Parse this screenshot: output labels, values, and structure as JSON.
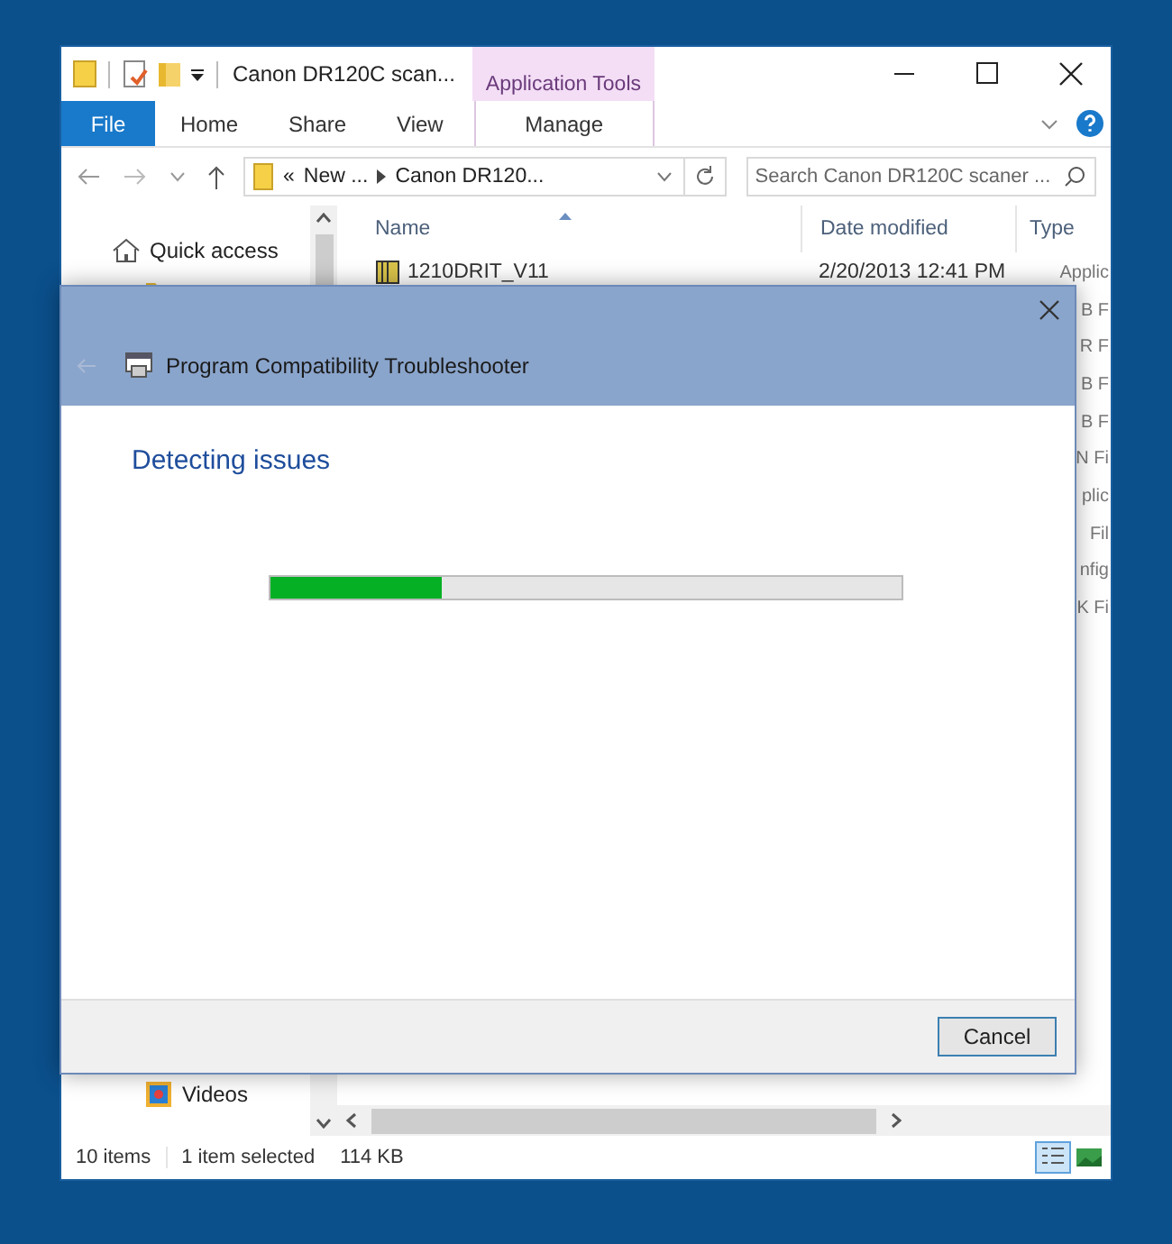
{
  "explorer": {
    "title": "Canon DR120C scan...",
    "context_tab": "Application Tools",
    "file_button": "File",
    "ribbon_tabs": [
      {
        "label": "Home",
        "kind": "normal"
      },
      {
        "label": "Share",
        "kind": "normal"
      },
      {
        "label": "View",
        "kind": "normal"
      },
      {
        "label": "Manage",
        "kind": "context"
      }
    ],
    "address": {
      "overflow": "«",
      "crumbs": [
        "New ...",
        "Canon DR120..."
      ]
    },
    "search": {
      "placeholder": "Search Canon DR120C scaner ..."
    },
    "nav_items": [
      {
        "label": "Quick access",
        "kind": "home"
      },
      {
        "kind": "folder"
      }
    ],
    "nav_bottom": [
      {
        "label": "Videos",
        "kind": "videos"
      }
    ],
    "columns": [
      "Name",
      "Date modified",
      "Type"
    ],
    "rows": [
      {
        "name": "1210DRIT_V11",
        "date": "2/20/2013 12:41 PM",
        "type": "Applic"
      },
      {
        "type": "B F"
      },
      {
        "type": "R F"
      },
      {
        "type": "B F"
      },
      {
        "type": "B F"
      },
      {
        "type": "N Fi"
      },
      {
        "type": "plic"
      },
      {
        "type": "Fil"
      },
      {
        "type": "nfig"
      },
      {
        "type": "K Fi"
      }
    ],
    "status": [
      "10 items",
      "1 item selected",
      "114 KB"
    ]
  },
  "dialog": {
    "title": "Program Compatibility Troubleshooter",
    "heading": "Detecting issues",
    "progress": {
      "level": 0.27
    },
    "buttons": [
      "Cancel"
    ]
  }
}
